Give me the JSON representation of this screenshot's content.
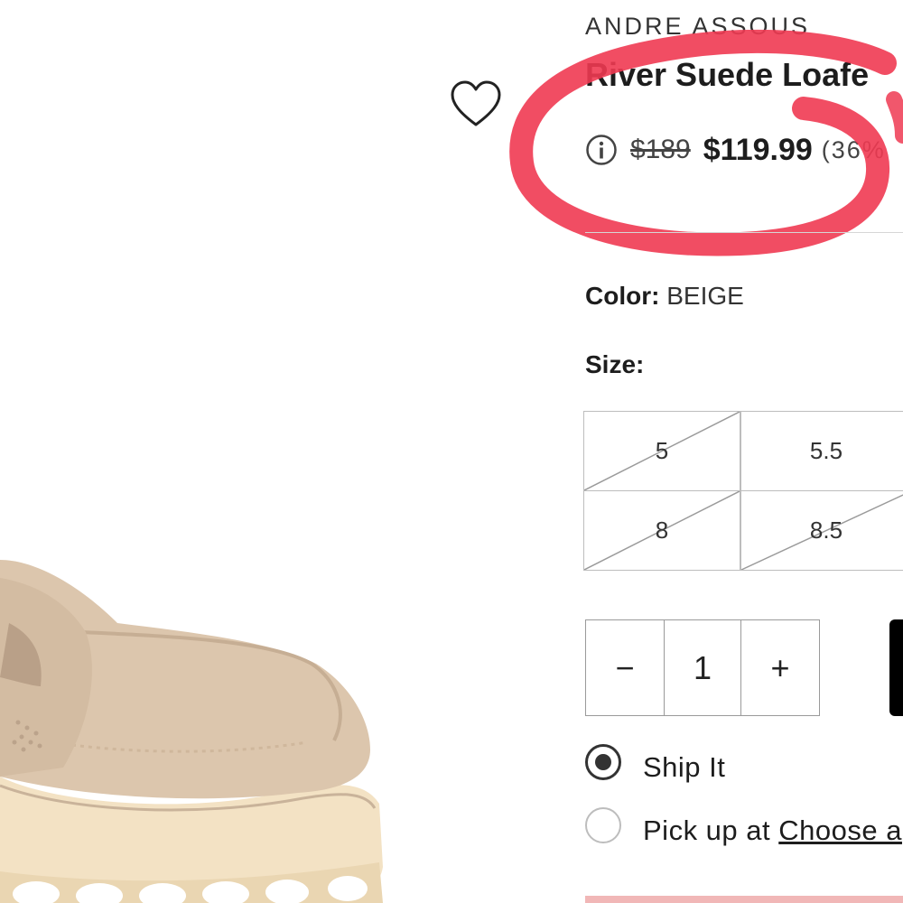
{
  "product": {
    "brand": "ANDRE ASSOUS",
    "title": "River Suede Loafe",
    "image_icon": "beige-suede-loafer"
  },
  "price": {
    "original": "$189",
    "sale": "$119.99",
    "discount": "(36%"
  },
  "color": {
    "label": "Color:",
    "value": "BEIGE"
  },
  "size": {
    "label": "Size:",
    "options": [
      {
        "label": "5",
        "available": false
      },
      {
        "label": "5.5",
        "available": true
      },
      {
        "label": "8",
        "available": false
      },
      {
        "label": "8.5",
        "available": false
      }
    ]
  },
  "quantity": {
    "minus": "−",
    "value": "1",
    "plus": "+"
  },
  "fulfillment": {
    "ship_label": "Ship It",
    "ship_selected": true,
    "pickup_prefix": "Pick up at",
    "pickup_link": "Choose a"
  },
  "colors": {
    "marker": "#ef3a52",
    "text": "#1d1d1d",
    "border": "#bdbdbd",
    "shoe": "#dcc6ad"
  },
  "icons": {
    "wishlist": "heart-outline-icon",
    "info": "info-circle-icon"
  }
}
